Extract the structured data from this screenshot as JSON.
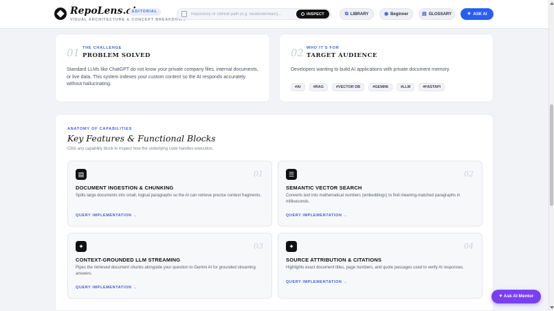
{
  "header": {
    "brand": "RepoLens.ai",
    "badge": "EDITORIAL",
    "subtitle": "VISUAL ARCHITECTURE & CONCEPT BREAKDOWN",
    "search_placeholder": "Repository or GitHub path (e.g. facebook/react)...",
    "inspect_label": "INSPECT",
    "library_label": "LIBRARY",
    "level_label": "Beginner",
    "glossary_label": "GLOSSARY",
    "askai_label": "ASK AI"
  },
  "challenge": {
    "num": "01",
    "eyebrow": "THE CHALLENGE",
    "title": "PROBLEM SOLVED",
    "text": "Standard LLMs like ChatGPT do not know your private company files, internal documents, or live data. This system indexes your custom content so the AI responds accurately without hallucinating."
  },
  "audience": {
    "num": "02",
    "eyebrow": "WHO IT'S FOR",
    "title": "TARGET AUDIENCE",
    "text": "Developers wanting to build AI applications with private document memory.",
    "tags": [
      "#AI",
      "#RAG",
      "#VECTOR DB",
      "#GEMINI",
      "#LLM",
      "#FASTAPI"
    ]
  },
  "capabilities": {
    "eyebrow": "ANATOMY OF CAPABILITIES",
    "title": "Key Features & Functional Blocks",
    "subtitle": "Click any capability block to inspect how the underlying code handles execution.",
    "link_label": "QUERY IMPLEMENTATION →",
    "features": [
      {
        "num": "01",
        "icon": "document-icon",
        "title": "DOCUMENT INGESTION & CHUNKING",
        "text": "Splits large documents into small, logical paragraphs so the AI can retrieve precise context fragments."
      },
      {
        "num": "02",
        "icon": "database-icon",
        "title": "SEMANTIC VECTOR SEARCH",
        "text": "Converts text into mathematical numbers (embeddings) to find meaning-matched paragraphs in milliseconds."
      },
      {
        "num": "03",
        "icon": "sparkle-icon",
        "title": "CONTEXT-GROUNDED LLM STREAMING",
        "text": "Pipes the retrieved document chunks alongside your question to Gemini AI for grounded streaming answers."
      },
      {
        "num": "04",
        "icon": "sparkle-icon",
        "title": "SOURCE ATTRIBUTION & CITATIONS",
        "text": "Highlights exact document titles, page numbers, and quote passages used to verify AI responses."
      }
    ]
  },
  "mentor": {
    "label": "Ask AI Mentor"
  },
  "colors": {
    "accent": "#3b5bdb",
    "primary_button": "#2b5ef0",
    "mentor": "#7b3ff2"
  }
}
